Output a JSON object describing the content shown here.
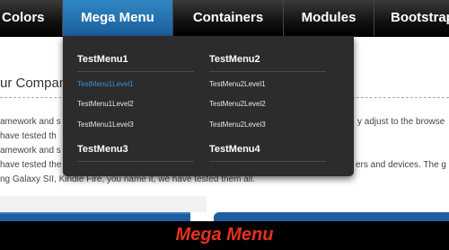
{
  "nav": {
    "items": [
      {
        "label": "Colors"
      },
      {
        "label": "Mega Menu"
      },
      {
        "label": "Containers"
      },
      {
        "label": "Modules"
      },
      {
        "label": "Bootstrap"
      }
    ],
    "active_index": 1
  },
  "background": {
    "heading": "ur Compan",
    "lines": [
      "amework and s",
      "have tested th",
      "amework and s",
      "have tested the",
      "ng Galaxy SII, Kindle Fire, you name it, we have tested them all.",
      "y adjust to the browse",
      "ers and devices. The g"
    ]
  },
  "mega_menu": {
    "columns": [
      {
        "heading": "TestMenu1",
        "links": [
          "TestMenu1Level1",
          "TestMenu1Level2",
          "TestMenu1Level3"
        ]
      },
      {
        "heading": "TestMenu2",
        "links": [
          "TestMenu2Level1",
          "TestMenu2Level2",
          "TestMenu2Level3"
        ]
      }
    ],
    "footer_headings": [
      "TestMenu3",
      "TestMenu4"
    ],
    "highlighted_link": "TestMenu1Level1"
  },
  "footer": {
    "title": "Mega Menu"
  },
  "colors": {
    "active_tab": "#1f6fb0",
    "highlight_link": "#3b8fd4",
    "footer_title": "#e6321e"
  }
}
